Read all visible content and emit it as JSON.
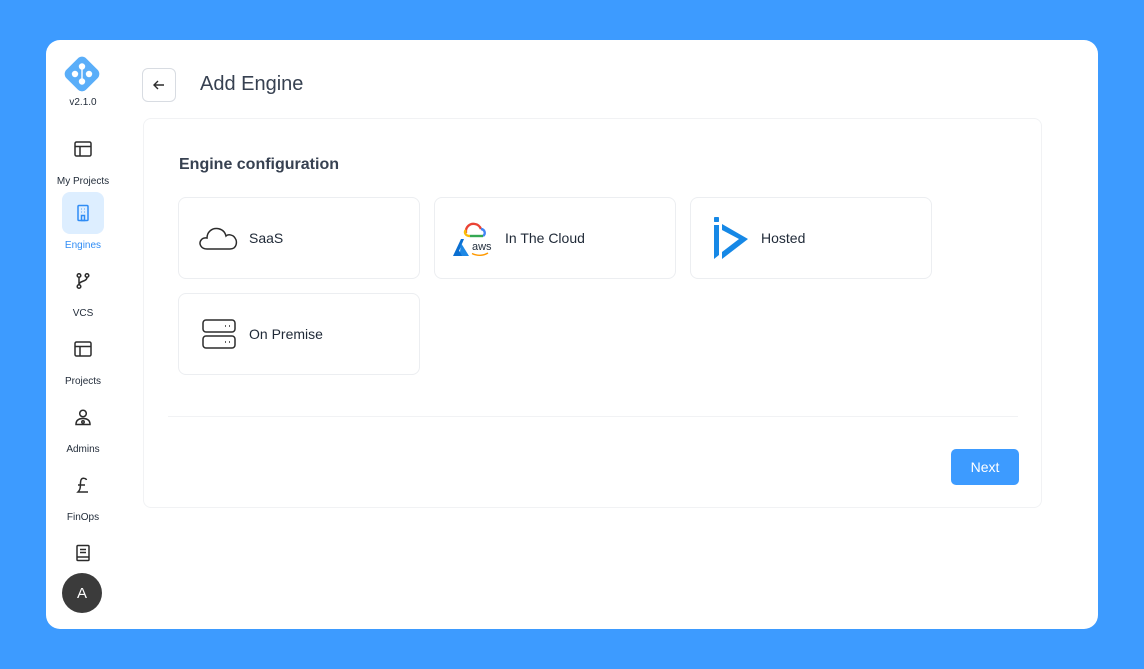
{
  "app": {
    "version": "v2.1.0"
  },
  "sidebar": {
    "items": [
      {
        "label": "My Projects",
        "icon": "layout-icon",
        "active": false
      },
      {
        "label": "Engines",
        "icon": "building-icon",
        "active": true
      },
      {
        "label": "VCS",
        "icon": "git-branch-icon",
        "active": false
      },
      {
        "label": "Projects",
        "icon": "layout-icon",
        "active": false
      },
      {
        "label": "Admins",
        "icon": "user-admin-icon",
        "active": false
      },
      {
        "label": "FinOps",
        "icon": "pound-icon",
        "active": false
      },
      {
        "label": "",
        "icon": "book-icon",
        "active": false
      }
    ],
    "avatar_initial": "A"
  },
  "header": {
    "title": "Add Engine"
  },
  "main": {
    "section_title": "Engine configuration",
    "options": [
      {
        "label": "SaaS",
        "icon": "cloud-icon"
      },
      {
        "label": "In The Cloud",
        "icon": "multi-cloud-icon"
      },
      {
        "label": "Hosted",
        "icon": "hosted-logo-icon"
      },
      {
        "label": "On Premise",
        "icon": "server-icon"
      }
    ],
    "next_label": "Next"
  },
  "colors": {
    "background": "#3d9bff",
    "accent": "#3d9bff",
    "active_bg": "#ddeeff",
    "active_text": "#2f8cf5",
    "avatar_bg": "#3b3b3b"
  }
}
